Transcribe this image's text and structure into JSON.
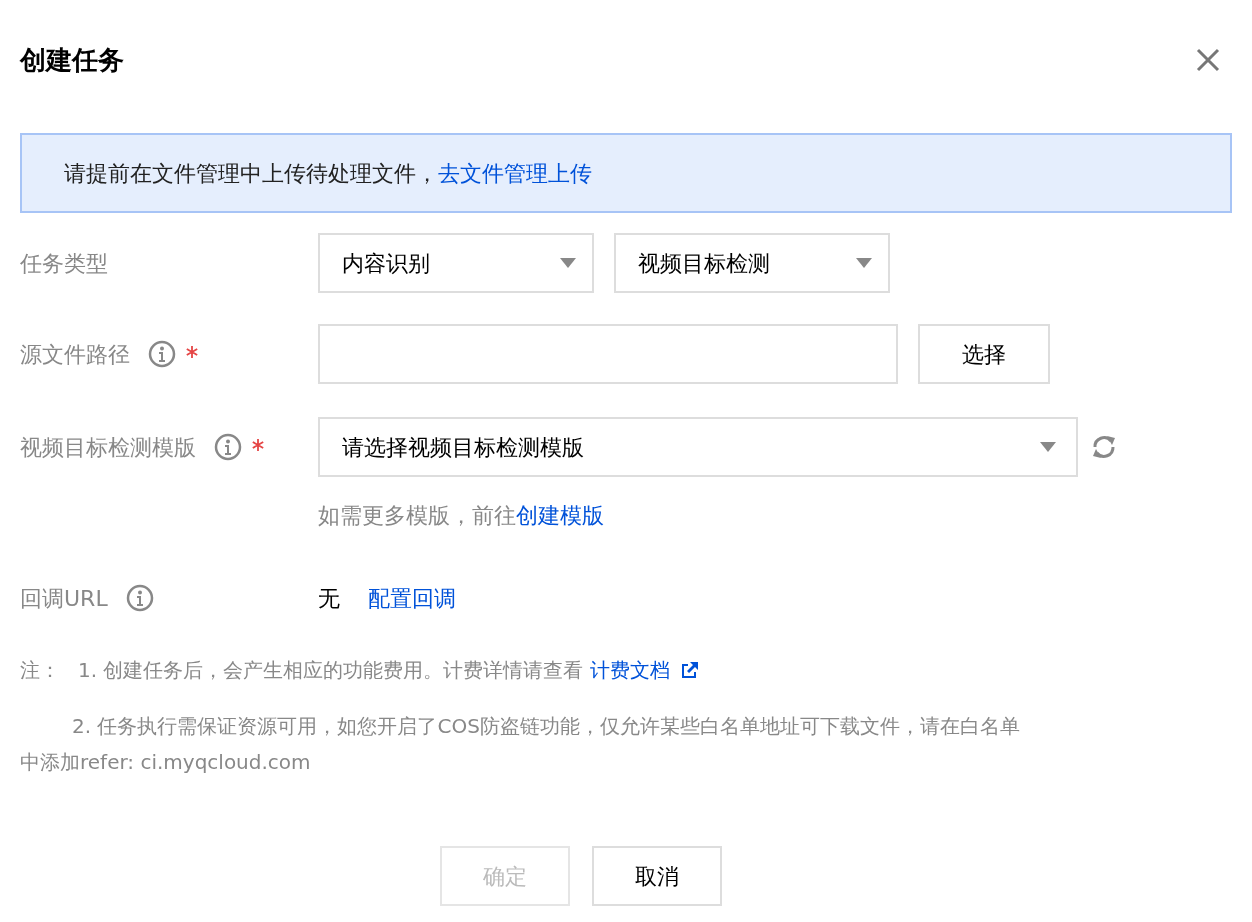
{
  "title": "创建任务",
  "notice": {
    "text": "请提前在文件管理中上传待处理文件，",
    "link": "去文件管理上传"
  },
  "task_type": {
    "label": "任务类型",
    "info": false,
    "required": false,
    "selects": [
      {
        "value": "内容识别"
      },
      {
        "value": "视频目标检测"
      }
    ]
  },
  "source_path": {
    "label": "源文件路径",
    "info": true,
    "required": true,
    "button": "选择"
  },
  "template": {
    "label": "视频目标检测模版",
    "info": true,
    "required": true,
    "placeholder": "请选择视频目标检测模版",
    "hint": "如需更多模版，前往",
    "hint_link": "创建模版"
  },
  "callback": {
    "label": "回调URL",
    "info": true,
    "required": false,
    "value": "无",
    "link": "配置回调"
  },
  "notes": {
    "label": "注：",
    "items": [
      {
        "text": "1. 创建任务后，会产生相应的功能费用。计费详情请查看",
        "link": "计费文档"
      },
      {
        "text": "2. 任务执行需保证资源可用，如您开启了COS防盗链功能，仅允许某些白名单地址可下载文件，请在白名单中添加refer: ci.myqcloud.com"
      }
    ]
  },
  "buttons": [
    {
      "label": "确定",
      "disabled": true
    },
    {
      "label": "取消",
      "disabled": false
    }
  ]
}
